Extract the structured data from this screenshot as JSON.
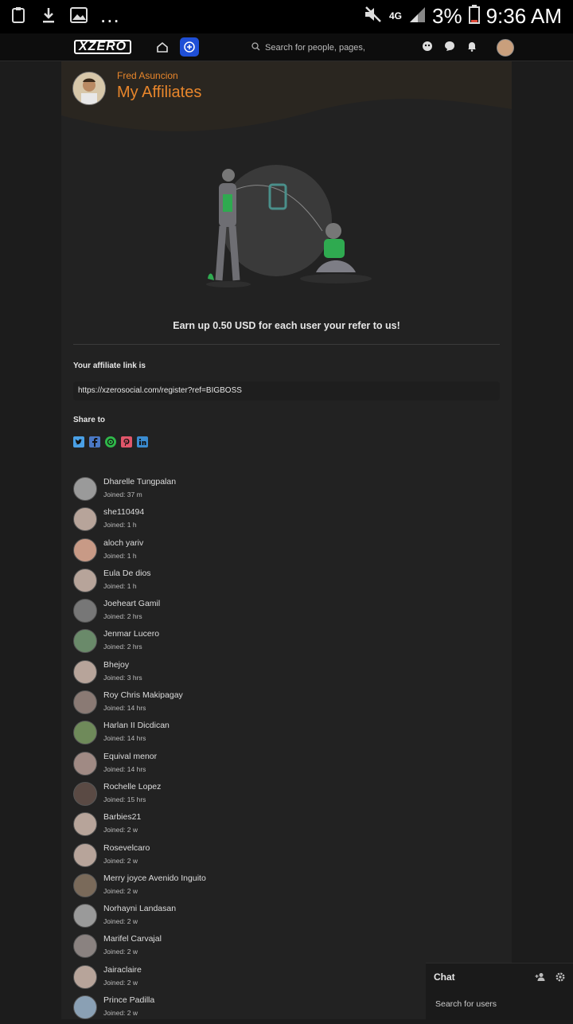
{
  "status_bar": {
    "network": "4G",
    "battery": "3%",
    "time": "9:36 AM",
    "dots": "..."
  },
  "nav": {
    "logo": "XZERO",
    "search_placeholder": "Search for people, pages,"
  },
  "hero": {
    "user_name": "Fred Asuncion",
    "title": "My Affiliates"
  },
  "main": {
    "earn_text": "Earn up 0.50 USD for each user your refer to us!",
    "affiliate_label": "Your affiliate link is",
    "affiliate_link": "https://xzerosocial.com/register?ref=BIGBOSS",
    "share_label": "Share to",
    "share_icons": [
      "twitter-icon",
      "facebook-icon",
      "whatsapp-icon",
      "pinterest-icon",
      "linkedin-icon"
    ],
    "share_colors": [
      "#4aa0e6",
      "#4a78c4",
      "#2fb84a",
      "#e0566a",
      "#3a8bd0"
    ]
  },
  "affiliates": [
    {
      "name": "Dharelle Tungpalan",
      "joined": "Joined: 37 m"
    },
    {
      "name": "she110494",
      "joined": "Joined: 1 h"
    },
    {
      "name": "aloch yariv",
      "joined": "Joined: 1 h"
    },
    {
      "name": "Eula De dios",
      "joined": "Joined: 1 h"
    },
    {
      "name": "Joeheart Gamil",
      "joined": "Joined: 2 hrs"
    },
    {
      "name": "Jenmar Lucero",
      "joined": "Joined: 2 hrs"
    },
    {
      "name": "Bhejoy",
      "joined": "Joined: 3 hrs"
    },
    {
      "name": "Roy Chris Makipagay",
      "joined": "Joined: 14 hrs"
    },
    {
      "name": "Harlan II Dicdican",
      "joined": "Joined: 14 hrs"
    },
    {
      "name": "Equival menor",
      "joined": "Joined: 14 hrs"
    },
    {
      "name": "Rochelle Lopez",
      "joined": "Joined: 15 hrs"
    },
    {
      "name": "Barbies21",
      "joined": "Joined: 2 w"
    },
    {
      "name": "Rosevelcaro",
      "joined": "Joined: 2 w"
    },
    {
      "name": "Merry joyce Avenido Inguito",
      "joined": "Joined: 2 w"
    },
    {
      "name": "Norhayni Landasan",
      "joined": "Joined: 2 w"
    },
    {
      "name": "Marifel Carvajal",
      "joined": "Joined: 2 w"
    },
    {
      "name": "Jairaclaire",
      "joined": "Joined: 2 w"
    },
    {
      "name": "Prince Padilla",
      "joined": "Joined: 2 w"
    }
  ],
  "chat": {
    "title": "Chat",
    "search_placeholder": "Search for users"
  },
  "colors": {
    "accent": "#e8862b",
    "create_button": "#1f4fd6",
    "background": "#1c1c1c",
    "card": "#222222"
  }
}
